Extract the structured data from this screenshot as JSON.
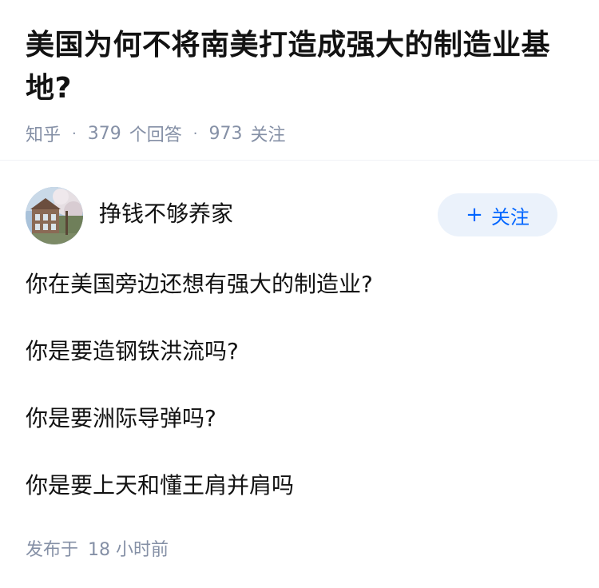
{
  "question": {
    "title": "美国为何不将南美打造成强大的制造业基地?",
    "source": "知乎",
    "answer_count": "379",
    "answer_label": "个回答",
    "follower_count": "973",
    "follower_label": "关注"
  },
  "author": {
    "name": "挣钱不够养家",
    "follow_label": "关注",
    "follow_icon": "plus-icon"
  },
  "answer": {
    "paragraphs": [
      "你在美国旁边还想有强大的制造业?",
      "你是要造钢铁洪流吗?",
      "你是要洲际导弹吗?",
      "你是要上天和懂王肩并肩吗"
    ]
  },
  "publish": {
    "prefix": "发布于",
    "time": "18 小时前"
  },
  "colors": {
    "accent": "#0066ff",
    "follow_bg": "#ebf2fb",
    "meta_text": "#8590a6",
    "body_text": "#121212"
  }
}
